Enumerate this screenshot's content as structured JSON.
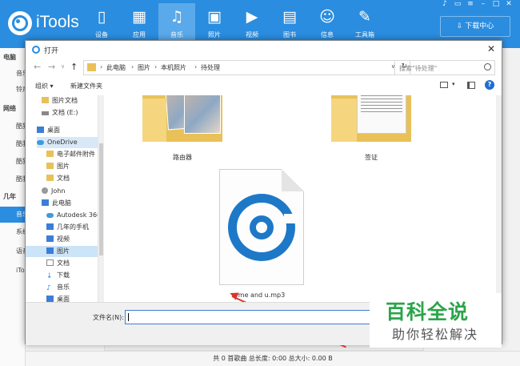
{
  "app": {
    "name": "iTools",
    "nav": [
      {
        "label": "设备",
        "icon": "phone-icon"
      },
      {
        "label": "应用",
        "icon": "apps-icon"
      },
      {
        "label": "音乐",
        "icon": "music-icon"
      },
      {
        "label": "照片",
        "icon": "photo-icon"
      },
      {
        "label": "视频",
        "icon": "video-icon"
      },
      {
        "label": "图书",
        "icon": "book-icon"
      },
      {
        "label": "信息",
        "icon": "person-icon"
      },
      {
        "label": "工具箱",
        "icon": "wrench-icon"
      }
    ],
    "active_nav": "音乐",
    "download_center": "下载中心",
    "left_panel": [
      "电脑",
      "音乐",
      "铃声",
      "网络",
      "酷狗",
      "酷我",
      "酷狗",
      "酷我",
      "几年",
      "音乐",
      "系统",
      "语音",
      "iTo"
    ],
    "status": "共 0 首歌曲  总长度: 0:00  总大小: 0.00 B",
    "accent_color": "#2a8de0"
  },
  "dialog": {
    "title": "打开",
    "breadcrumb": [
      "此电脑",
      "图片",
      "本机照片",
      "待处理"
    ],
    "search_placeholder": "搜索\"待处理\"",
    "toolbar": {
      "organize": "组织 ▾",
      "new_folder": "新建文件夹"
    },
    "tree": [
      {
        "label": "图片文档",
        "icon": "folder"
      },
      {
        "label": "文档 (E:)",
        "icon": "drive"
      },
      {
        "label": "桌面",
        "icon": "blue"
      },
      {
        "label": "OneDrive",
        "icon": "cloud"
      },
      {
        "label": "电子邮件附件",
        "icon": "folder"
      },
      {
        "label": "图片",
        "icon": "folder"
      },
      {
        "label": "文档",
        "icon": "folder"
      },
      {
        "label": "John",
        "icon": "person"
      },
      {
        "label": "此电脑",
        "icon": "blue"
      },
      {
        "label": "Autodesk 360",
        "icon": "cloud"
      },
      {
        "label": "几年的手机",
        "icon": "blue"
      },
      {
        "label": "视频",
        "icon": "blue"
      },
      {
        "label": "图片",
        "icon": "blue"
      },
      {
        "label": "文档",
        "icon": "doc"
      },
      {
        "label": "下载",
        "icon": "arrow"
      },
      {
        "label": "音乐",
        "icon": "music"
      },
      {
        "label": "桌面",
        "icon": "blue"
      }
    ],
    "files": [
      {
        "name": "路由器",
        "kind": "folder-photo"
      },
      {
        "name": "签证",
        "kind": "folder-doc"
      },
      {
        "name": "me and u.mp3",
        "kind": "mp3"
      }
    ],
    "filename_label": "文件名(N):",
    "filename_value": ""
  },
  "watermark": {
    "title": "百科全说",
    "subtitle": "助你轻松解决"
  }
}
